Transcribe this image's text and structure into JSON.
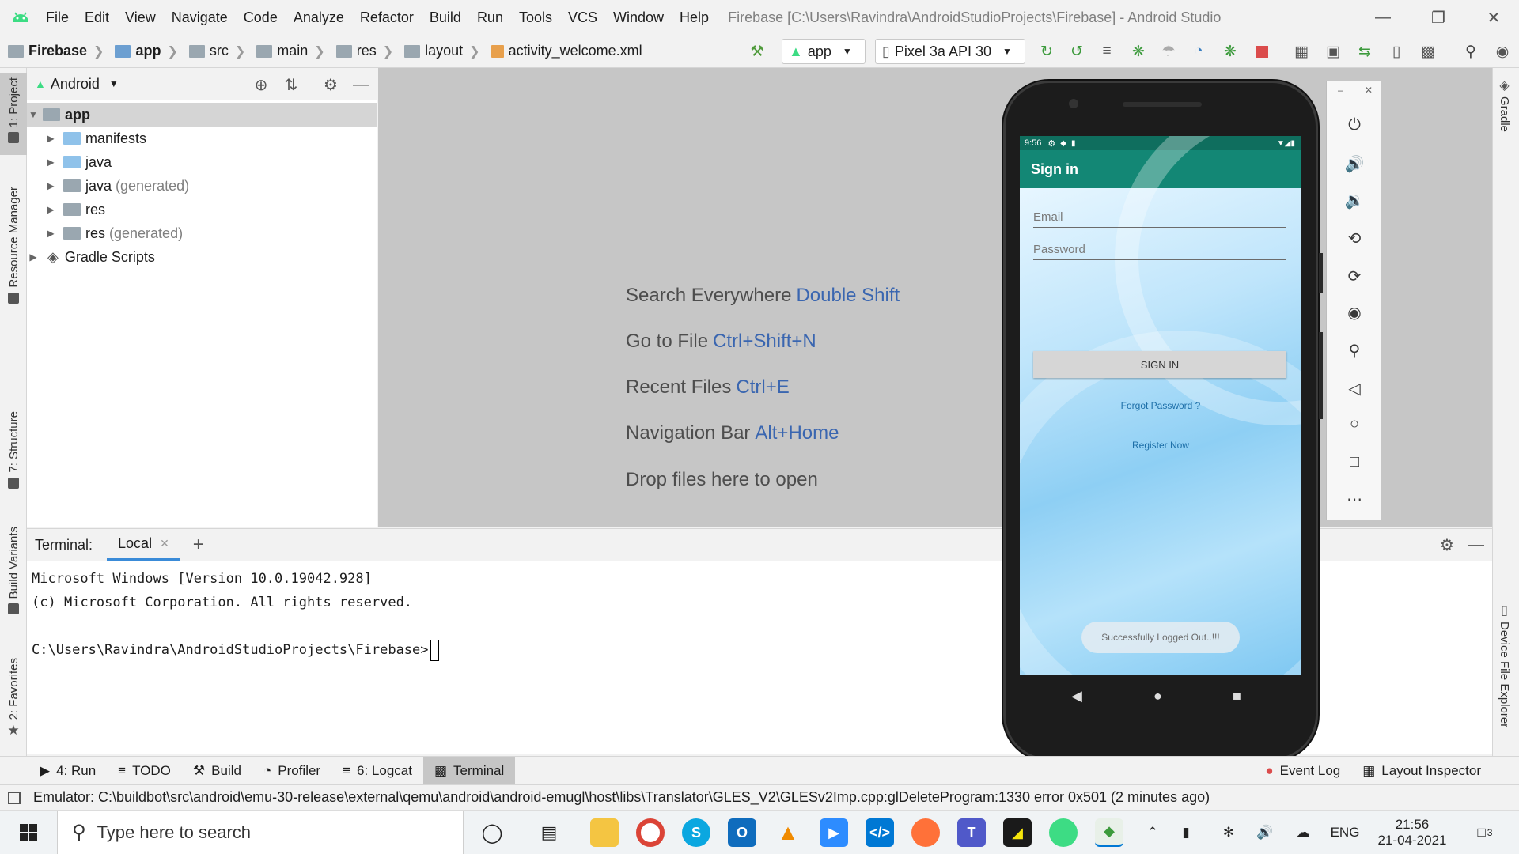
{
  "window": {
    "title": "Firebase [C:\\Users\\Ravindra\\AndroidStudioProjects\\Firebase] - Android Studio"
  },
  "menu": [
    "File",
    "Edit",
    "View",
    "Navigate",
    "Code",
    "Analyze",
    "Refactor",
    "Build",
    "Run",
    "Tools",
    "VCS",
    "Window",
    "Help"
  ],
  "breadcrumb": [
    "Firebase",
    "app",
    "src",
    "main",
    "res",
    "layout",
    "activity_welcome.xml"
  ],
  "run_config": "app",
  "device": "Pixel 3a API 30",
  "left_tabs": [
    "1: Project",
    "Resource Manager",
    "7: Structure",
    "Build Variants",
    "2: Favorites"
  ],
  "right_tabs": [
    "Gradle",
    "Device File Explorer"
  ],
  "project": {
    "view": "Android",
    "tree": [
      {
        "label": "app",
        "note": ""
      },
      {
        "label": "manifests",
        "note": ""
      },
      {
        "label": "java",
        "note": ""
      },
      {
        "label": "java",
        "note": "(generated)"
      },
      {
        "label": "res",
        "note": ""
      },
      {
        "label": "res",
        "note": "(generated)"
      },
      {
        "label": "Gradle Scripts",
        "note": ""
      }
    ]
  },
  "editor_hints": [
    {
      "text": "Search Everywhere",
      "key": "Double Shift"
    },
    {
      "text": "Go to File",
      "key": "Ctrl+Shift+N"
    },
    {
      "text": "Recent Files",
      "key": "Ctrl+E"
    },
    {
      "text": "Navigation Bar",
      "key": "Alt+Home"
    },
    {
      "text": "Drop files here to open",
      "key": ""
    }
  ],
  "terminal": {
    "label": "Terminal:",
    "tab": "Local",
    "lines": [
      "Microsoft Windows [Version 10.0.19042.928]",
      "(c) Microsoft Corporation. All rights reserved.",
      "",
      "C:\\Users\\Ravindra\\AndroidStudioProjects\\Firebase>"
    ]
  },
  "bottom_tabs": [
    "4: Run",
    "TODO",
    "Build",
    "Profiler",
    "6: Logcat",
    "Terminal"
  ],
  "bottom_right_tabs": [
    "Event Log",
    "Layout Inspector"
  ],
  "status_message": "Emulator: C:\\buildbot\\src\\android\\emu-30-release\\external\\qemu\\android\\android-emugl\\host\\libs\\Translator\\GLES_V2\\GLESv2Imp.cpp:glDeleteProgram:1330 error 0x501 (2 minutes ago)",
  "phone": {
    "time": "9:56",
    "app_title": "Sign in",
    "email_placeholder": "Email",
    "password_placeholder": "Password",
    "signin_label": "SIGN IN",
    "forgot_label": "Forgot Password ?",
    "register_label": "Register Now",
    "toast": "Successfully Logged Out..!!!"
  },
  "taskbar": {
    "search_placeholder": "Type here to search",
    "language": "ENG",
    "time": "21:56",
    "date": "21-04-2021",
    "notifications": "3"
  },
  "colors": {
    "accent": "#3a66b0",
    "app_bar": "#138775",
    "status_bar": "#0f6e5e"
  }
}
